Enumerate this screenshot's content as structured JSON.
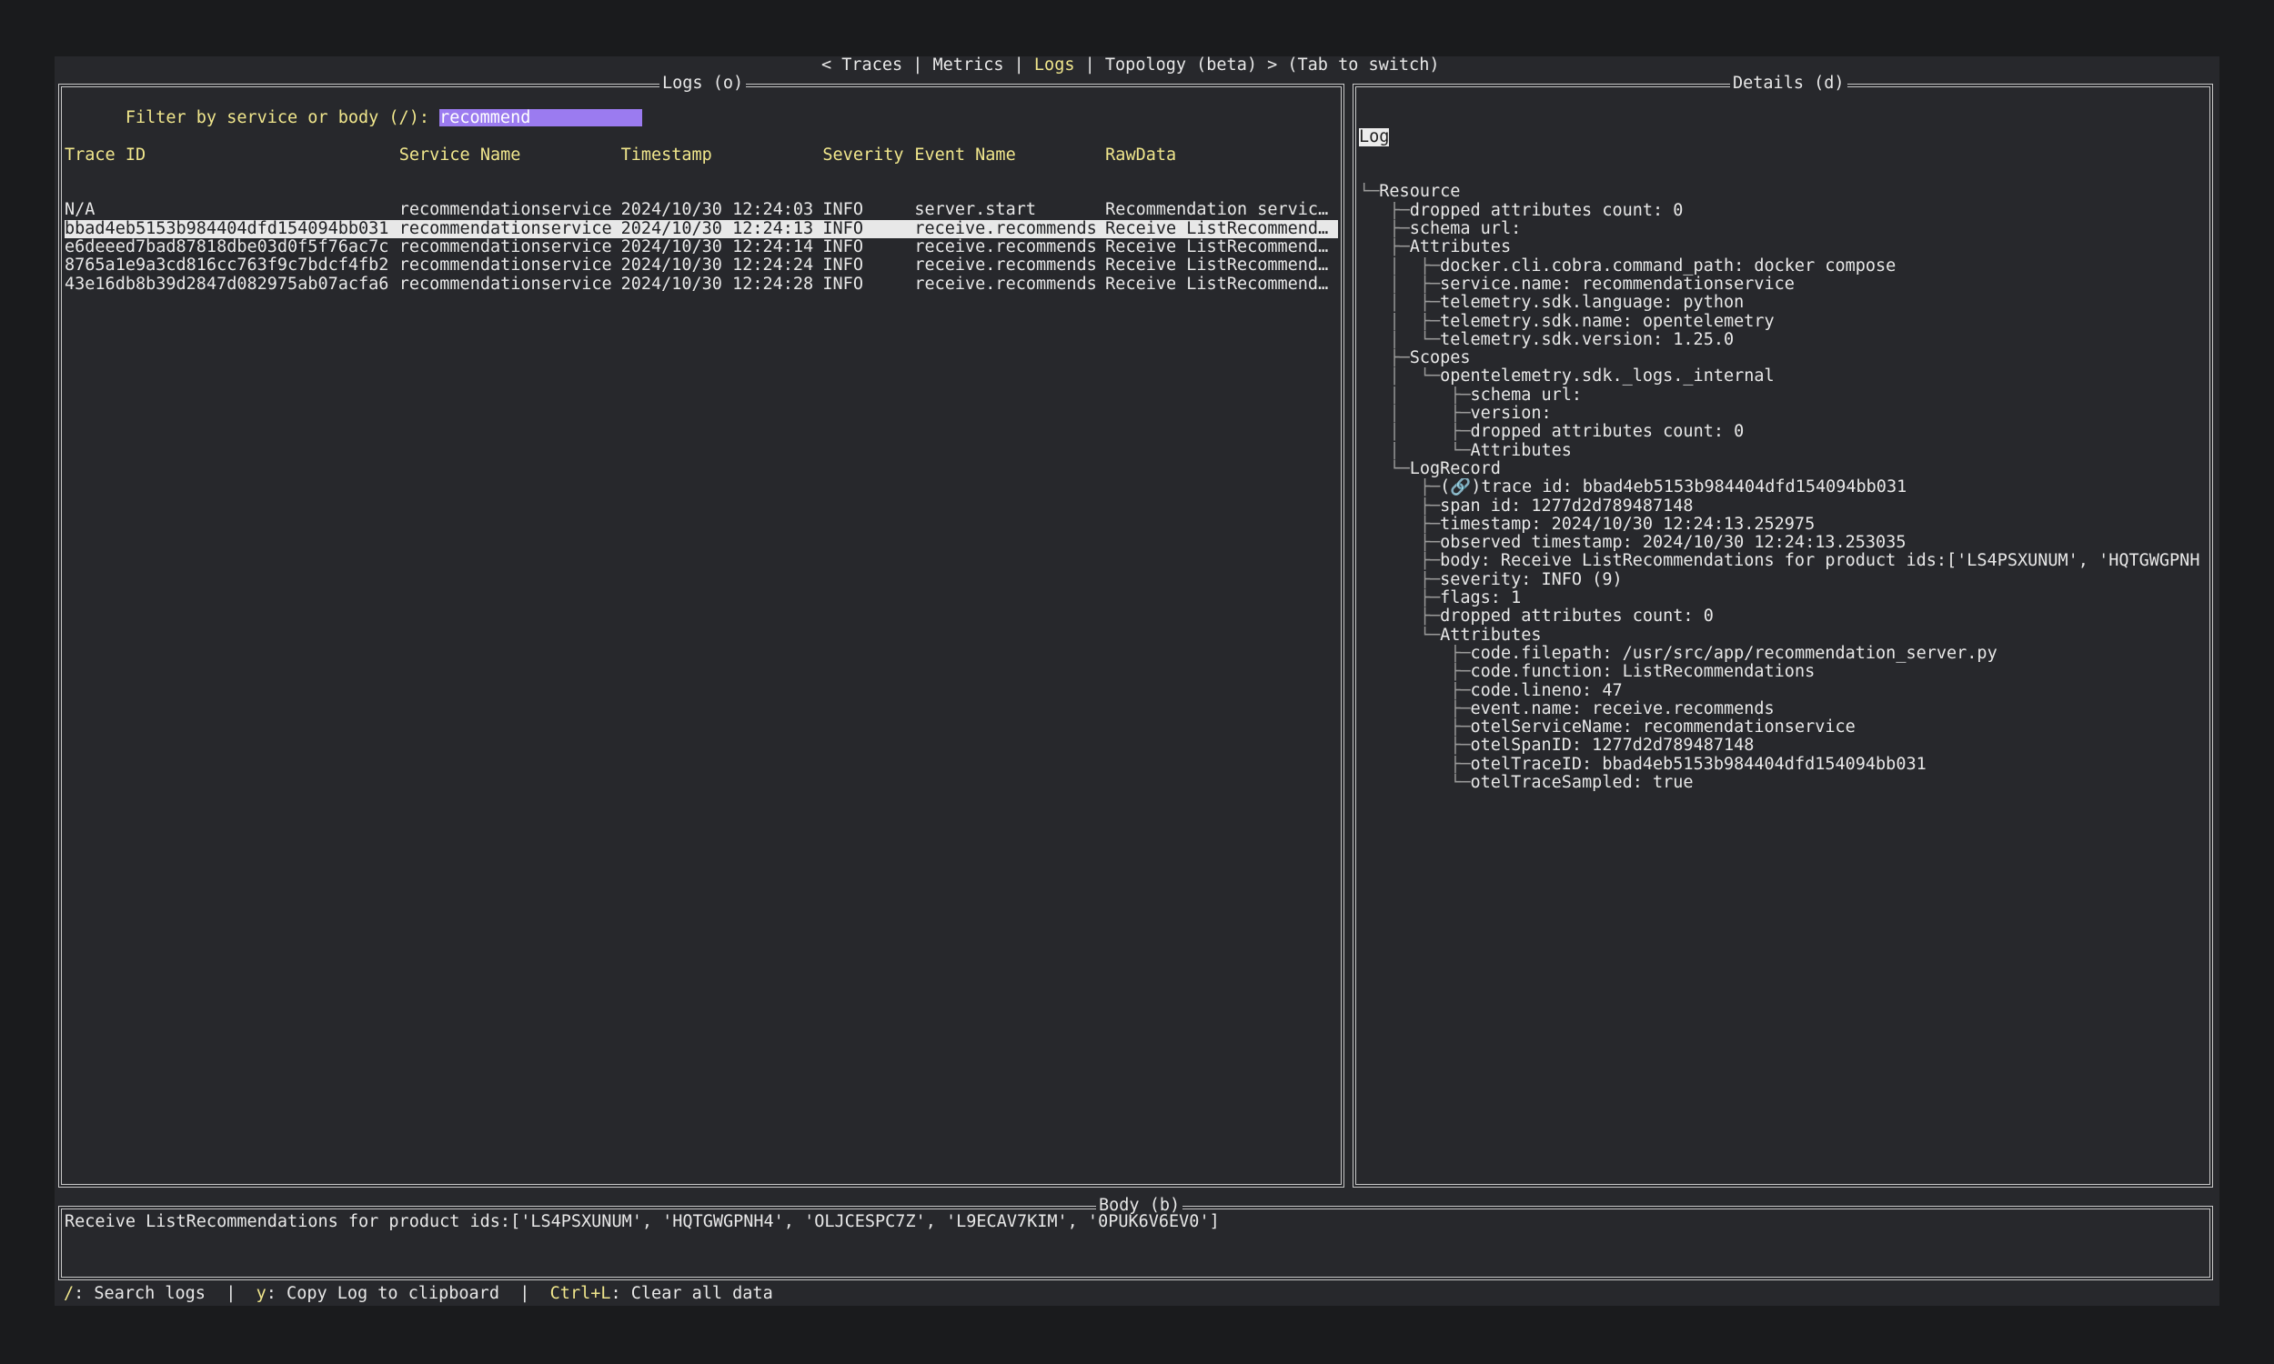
{
  "tabs": {
    "prefix": "< ",
    "items": [
      "Traces",
      "Metrics",
      "Logs",
      "Topology (beta)"
    ],
    "active": "Logs",
    "separator": " | ",
    "suffix": " > (Tab to switch)"
  },
  "logs_panel": {
    "title": "Logs (o)",
    "filter_label": "Filter by service or body (/): ",
    "filter_value": "recommend",
    "columns": [
      "Trace ID",
      "Service Name",
      "Timestamp",
      "Severity",
      "Event Name",
      "RawData"
    ],
    "rows": [
      [
        "N/A",
        "recommendationservice",
        "2024/10/30 12:24:03",
        "INFO",
        "server.start",
        "Recommendation service…"
      ],
      [
        "bbad4eb5153b984404dfd154094bb031",
        "recommendationservice",
        "2024/10/30 12:24:13",
        "INFO",
        "receive.recommends",
        "Receive ListRecommenda…"
      ],
      [
        "e6deeed7bad87818dbe03d0f5f76ac7c",
        "recommendationservice",
        "2024/10/30 12:24:14",
        "INFO",
        "receive.recommends",
        "Receive ListRecommenda…"
      ],
      [
        "8765a1e9a3cd816cc763f9c7bdcf4fb2",
        "recommendationservice",
        "2024/10/30 12:24:24",
        "INFO",
        "receive.recommends",
        "Receive ListRecommenda…"
      ],
      [
        "43e16db8b39d2847d082975ab07acfa6",
        "recommendationservice",
        "2024/10/30 12:24:28",
        "INFO",
        "receive.recommends",
        "Receive ListRecommenda…"
      ]
    ],
    "selected_index": 1
  },
  "details_panel": {
    "title": "Details (d)",
    "root": "Log",
    "lines": [
      {
        "guide": "└─",
        "text": "Resource"
      },
      {
        "guide": "   ├─",
        "text": "dropped attributes count: 0"
      },
      {
        "guide": "   ├─",
        "text": "schema url:"
      },
      {
        "guide": "   ├─",
        "text": "Attributes"
      },
      {
        "guide": "   │  ├─",
        "text": "docker.cli.cobra.command_path: docker compose"
      },
      {
        "guide": "   │  ├─",
        "text": "service.name: recommendationservice"
      },
      {
        "guide": "   │  ├─",
        "text": "telemetry.sdk.language: python"
      },
      {
        "guide": "   │  ├─",
        "text": "telemetry.sdk.name: opentelemetry"
      },
      {
        "guide": "   │  └─",
        "text": "telemetry.sdk.version: 1.25.0"
      },
      {
        "guide": "   ├─",
        "text": "Scopes"
      },
      {
        "guide": "   │  └─",
        "text": "opentelemetry.sdk._logs._internal"
      },
      {
        "guide": "   │     ├─",
        "text": "schema url:"
      },
      {
        "guide": "   │     ├─",
        "text": "version:"
      },
      {
        "guide": "   │     ├─",
        "text": "dropped attributes count: 0"
      },
      {
        "guide": "   │     └─",
        "text": "Attributes"
      },
      {
        "guide": "   └─",
        "text": "LogRecord"
      },
      {
        "guide": "      ├─",
        "text": "(🔗)trace id: bbad4eb5153b984404dfd154094bb031"
      },
      {
        "guide": "      ├─",
        "text": "span id: 1277d2d789487148"
      },
      {
        "guide": "      ├─",
        "text": "timestamp: 2024/10/30 12:24:13.252975"
      },
      {
        "guide": "      ├─",
        "text": "observed timestamp: 2024/10/30 12:24:13.253035"
      },
      {
        "guide": "      ├─",
        "text": "body: Receive ListRecommendations for product ids:['LS4PSXUNUM', 'HQTGWGPNH"
      },
      {
        "guide": "      ├─",
        "text": "severity: INFO (9)"
      },
      {
        "guide": "      ├─",
        "text": "flags: 1"
      },
      {
        "guide": "      ├─",
        "text": "dropped attributes count: 0"
      },
      {
        "guide": "      └─",
        "text": "Attributes"
      },
      {
        "guide": "         ├─",
        "text": "code.filepath: /usr/src/app/recommendation_server.py"
      },
      {
        "guide": "         ├─",
        "text": "code.function: ListRecommendations"
      },
      {
        "guide": "         ├─",
        "text": "code.lineno: 47"
      },
      {
        "guide": "         ├─",
        "text": "event.name: receive.recommends"
      },
      {
        "guide": "         ├─",
        "text": "otelServiceName: recommendationservice"
      },
      {
        "guide": "         ├─",
        "text": "otelSpanID: 1277d2d789487148"
      },
      {
        "guide": "         ├─",
        "text": "otelTraceID: bbad4eb5153b984404dfd154094bb031"
      },
      {
        "guide": "         └─",
        "text": "otelTraceSampled: true"
      }
    ]
  },
  "body_panel": {
    "title": "Body (b)",
    "text": "Receive ListRecommendations for product ids:['LS4PSXUNUM', 'HQTGWGPNH4', 'OLJCESPC7Z', 'L9ECAV7KIM', '0PUK6V6EV0']"
  },
  "footer": {
    "items": [
      {
        "key": "/",
        "desc": ": Search logs"
      },
      {
        "key": "y",
        "desc": ": Copy Log to clipboard"
      },
      {
        "key": "Ctrl+L",
        "desc": ": Clear all data"
      }
    ],
    "separator": "  |  "
  },
  "colors": {
    "accent_yellow": "#f0e68c",
    "input_bg": "#9b7bf0",
    "panel_bg": "#27282c"
  }
}
